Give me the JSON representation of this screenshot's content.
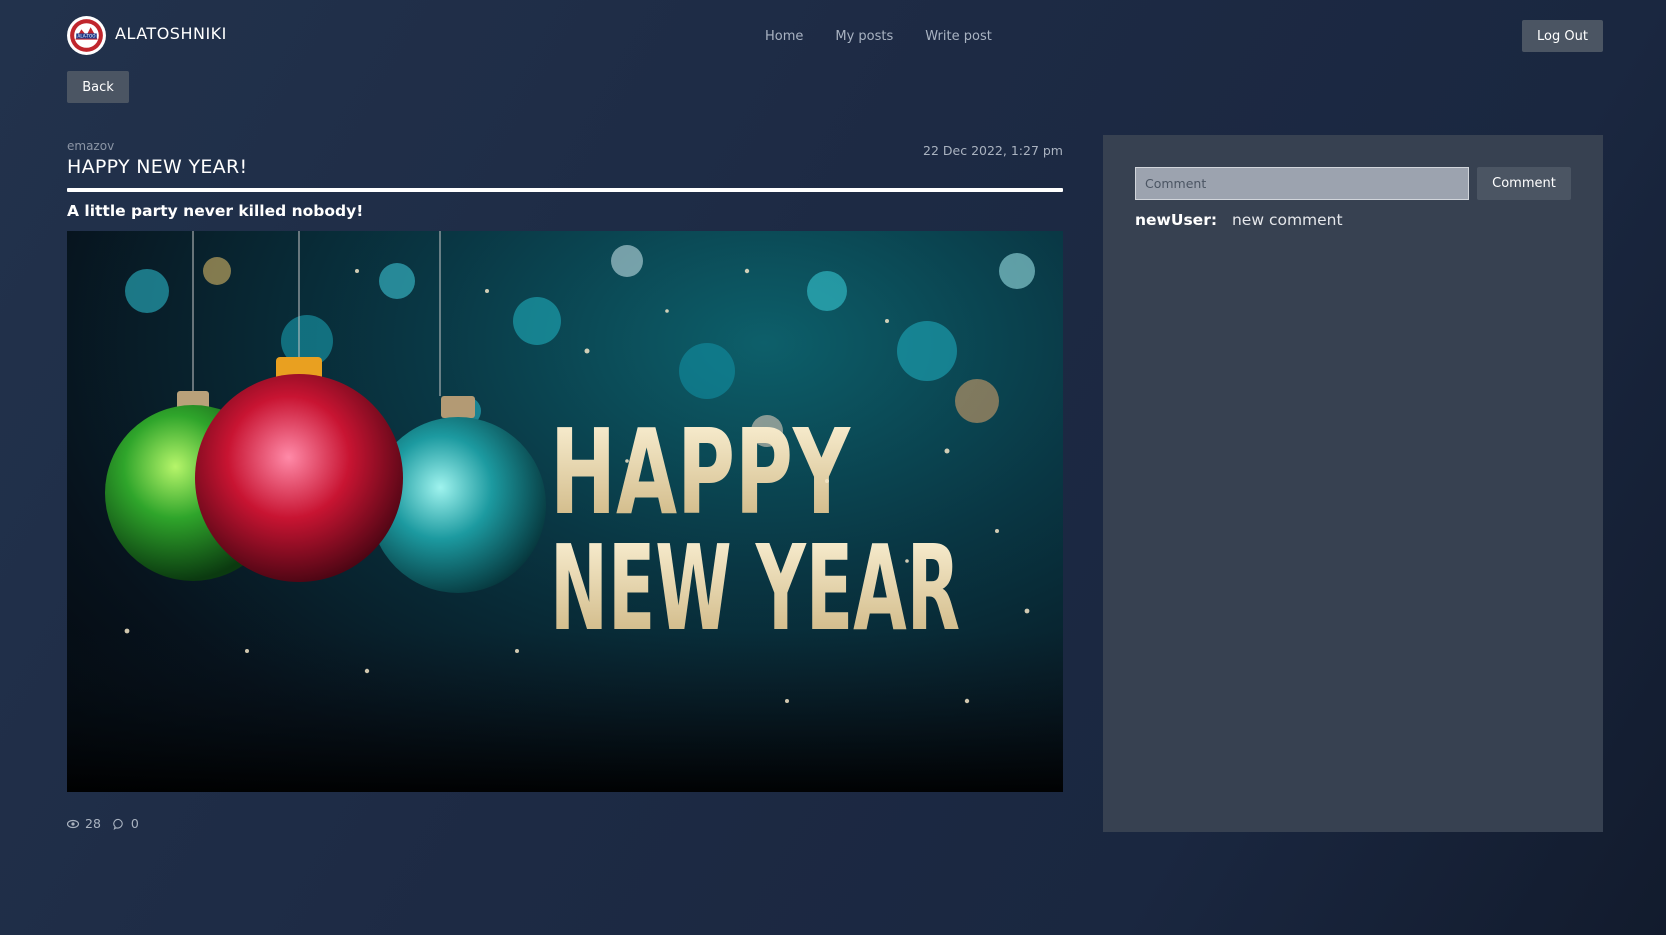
{
  "header": {
    "brand": "ALATOSHNIKI",
    "logo_text": "ALA-TOO",
    "nav": [
      "Home",
      "My posts",
      "Write post"
    ],
    "logout_label": "Log Out"
  },
  "back_label": "Back",
  "post": {
    "author": "emazov",
    "date": "22 Dec 2022, 1:27 pm",
    "title": "HAPPY NEW YEAR!",
    "subtitle": "A little party never killed nobody!",
    "image_text": [
      "HAPPY",
      "NEW YEAR"
    ],
    "views": "28",
    "comments_count": "0",
    "icons": {
      "views": "eye-icon",
      "comments": "comment-bubble-icon"
    }
  },
  "comments": {
    "input_placeholder": "Comment",
    "input_value": "",
    "button_label": "Comment",
    "items": [
      {
        "user": "newUser:",
        "text": "new comment"
      }
    ]
  },
  "colors": {
    "background": "#1d2a44",
    "panel": "#374151",
    "button": "#4b5563",
    "logo_red": "#c0262d"
  }
}
